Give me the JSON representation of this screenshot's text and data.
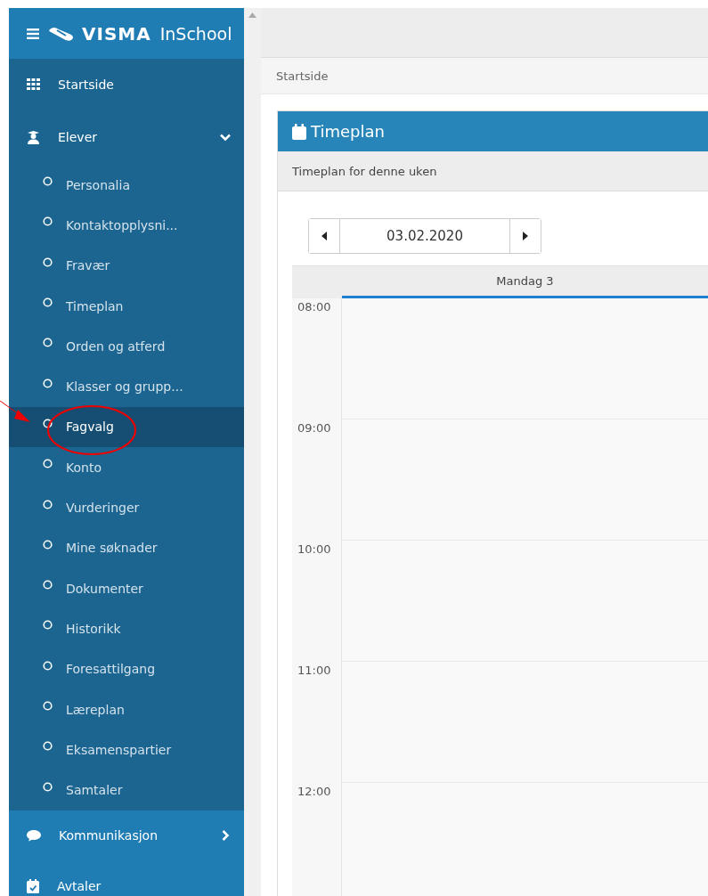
{
  "sidebar": {
    "logo": {
      "brand": "VISMA",
      "product": "InSchool"
    },
    "items": [
      {
        "label": "Startside",
        "kind": "link"
      },
      {
        "label": "Elever",
        "kind": "group",
        "expanded": true,
        "children": [
          {
            "label": "Personalia",
            "selected": false
          },
          {
            "label": "Kontaktopplysni...",
            "selected": false
          },
          {
            "label": "Fravær",
            "selected": false
          },
          {
            "label": "Timeplan",
            "selected": false
          },
          {
            "label": "Orden og atferd",
            "selected": false
          },
          {
            "label": "Klasser og grupp...",
            "selected": false
          },
          {
            "label": "Fagvalg",
            "selected": true
          },
          {
            "label": "Konto",
            "selected": false
          },
          {
            "label": "Vurderinger",
            "selected": false
          },
          {
            "label": "Mine søknader",
            "selected": false
          },
          {
            "label": "Dokumenter",
            "selected": false
          },
          {
            "label": "Historikk",
            "selected": false
          },
          {
            "label": "Foresattilgang",
            "selected": false
          },
          {
            "label": "Læreplan",
            "selected": false
          },
          {
            "label": "Eksamenspartier",
            "selected": false
          },
          {
            "label": "Samtaler",
            "selected": false
          }
        ]
      },
      {
        "label": "Kommunikasjon",
        "kind": "group",
        "expanded": false
      },
      {
        "label": "Avtaler",
        "kind": "link"
      }
    ]
  },
  "breadcrumb": "Startside",
  "panel": {
    "title": "Timeplan",
    "subtitle": "Timeplan for denne uken",
    "date_picker": {
      "value": "03.02.2020"
    },
    "calendar": {
      "day": "Mandag 3",
      "hours": [
        "08:00",
        "09:00",
        "10:00",
        "11:00",
        "12:00"
      ]
    }
  }
}
